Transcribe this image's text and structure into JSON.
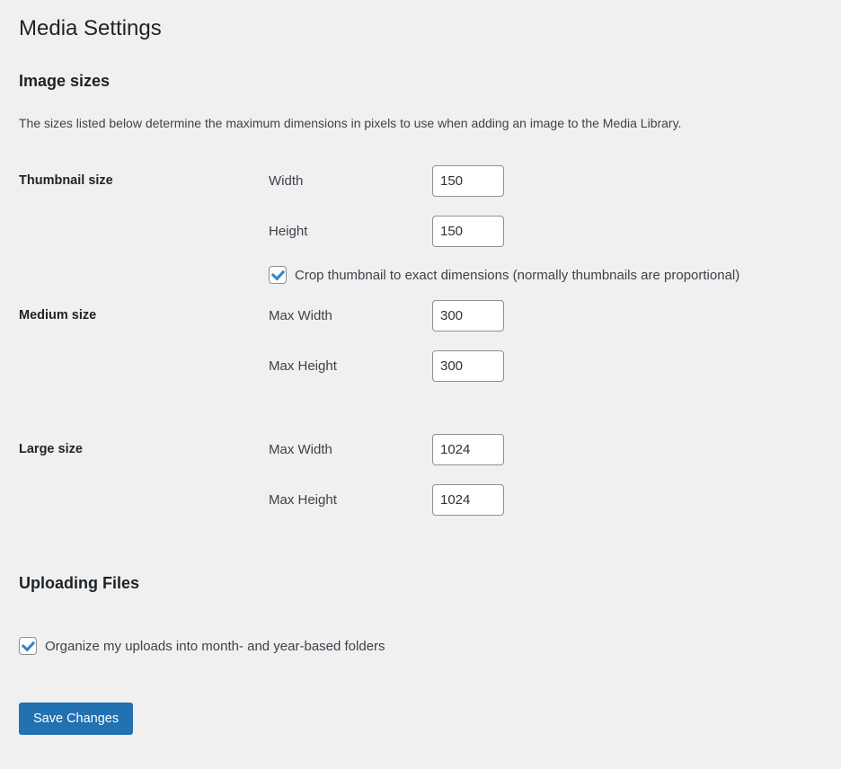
{
  "page": {
    "title": "Media Settings"
  },
  "colors": {
    "page_background": "#f0f0f1",
    "heading_text": "#1d2327",
    "body_text": "#3c434a",
    "input_border": "#8c8f94",
    "checkbox_check": "#3582c4",
    "button_background": "#2271b1",
    "button_text": "#ffffff"
  },
  "image_sizes": {
    "heading": "Image sizes",
    "description": "The sizes listed below determine the maximum dimensions in pixels to use when adding an image to the Media Library.",
    "thumbnail": {
      "label": "Thumbnail size",
      "fields": [
        {
          "label": "Width",
          "value": "150"
        },
        {
          "label": "Height",
          "value": "150"
        }
      ],
      "crop": {
        "label": "Crop thumbnail to exact dimensions (normally thumbnails are proportional)",
        "checked": true
      }
    },
    "medium": {
      "label": "Medium size",
      "fields": [
        {
          "label": "Max Width",
          "value": "300"
        },
        {
          "label": "Max Height",
          "value": "300"
        }
      ]
    },
    "large": {
      "label": "Large size",
      "fields": [
        {
          "label": "Max Width",
          "value": "1024"
        },
        {
          "label": "Max Height",
          "value": "1024"
        }
      ]
    }
  },
  "uploading_files": {
    "heading": "Uploading Files",
    "organize": {
      "label": "Organize my uploads into month- and year-based folders",
      "checked": true
    }
  },
  "save_button": {
    "label": "Save Changes"
  }
}
